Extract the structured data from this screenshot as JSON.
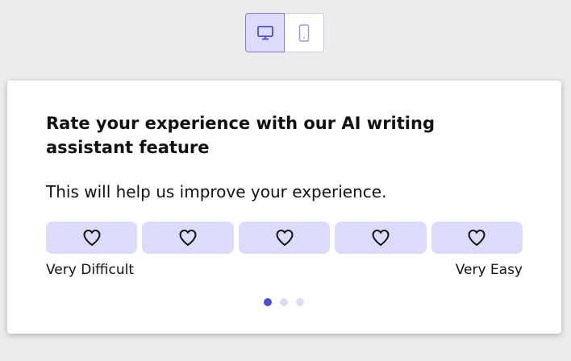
{
  "device_toggle": {
    "options": [
      {
        "icon": "desktop-icon",
        "active": true
      },
      {
        "icon": "mobile-icon",
        "active": false
      }
    ]
  },
  "survey": {
    "title": "Rate your experience with our AI writing assistant feature",
    "subtitle": "This will help us improve your experience.",
    "rating_count": 5,
    "rating_icon": "heart-icon",
    "label_low": "Very Difficult",
    "label_high": "Very Easy"
  },
  "pagination": {
    "total": 3,
    "current": 1
  },
  "colors": {
    "accent": "#4f4ad6",
    "accent_light": "#dcdcfa",
    "text": "#111111",
    "background": "#ececec"
  }
}
